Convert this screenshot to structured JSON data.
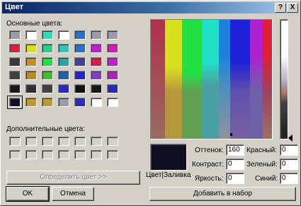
{
  "title": "Цвет",
  "title_buttons": {
    "help": "?",
    "close": "X"
  },
  "basic_colors_label": "Основные цвета:",
  "custom_colors_label": "Дополнительные цвета:",
  "define_button": "Определить цвет >>",
  "ok_button": "OK",
  "cancel_button": "Отмена",
  "add_button": "Добавить в набор",
  "color_solid_label": "Цвет|Заливка",
  "selected_color": "#110f22",
  "fields": {
    "hue": {
      "label": "Оттенок:",
      "value": "160"
    },
    "sat": {
      "label": "Контраст:",
      "value": "0"
    },
    "lum": {
      "label": "Яркость:",
      "value": "0"
    },
    "red": {
      "label": "Красный:",
      "value": "0"
    },
    "green": {
      "label": "Зеленый:",
      "value": "0"
    },
    "blue": {
      "label": "Синий:",
      "value": "0"
    }
  },
  "basic_colors": [
    "#9c9aa8",
    "#ffffff",
    "#2adfb8",
    "#ffffff",
    "#2a6ed0",
    "#9a9aa4",
    "#9a9aa4",
    "#e0203a",
    "#d8e020",
    "#22d090",
    "#30c4b8",
    "#2a6ed0",
    "#c020d0",
    "#d21cb4",
    "#3a3a3a",
    "#c09030",
    "#20e040",
    "#30a0a0",
    "#4040a0",
    "#d42048",
    "#c020d0",
    "#404040",
    "#b88a28",
    "#3cc030",
    "#2860a8",
    "#2424d0",
    "#8040c0",
    "#b020c0",
    "#181818",
    "#303030",
    "#404040",
    "#2828c0",
    "#101010",
    "#181818",
    "#2828c8",
    "#110f22",
    "#c09830",
    "#c09830",
    "#9c9aa8",
    "#2a2ac0",
    "#ffffff",
    "#ffffff"
  ]
}
